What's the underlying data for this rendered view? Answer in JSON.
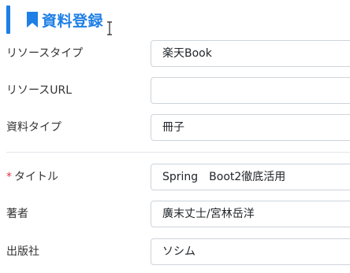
{
  "header": {
    "title": "資料登録"
  },
  "form": {
    "resource_type": {
      "label": "リソースタイプ",
      "value": "楽天Book"
    },
    "resource_url": {
      "label": "リソースURL",
      "value": ""
    },
    "material_type": {
      "label": "資料タイプ",
      "value": "冊子"
    },
    "title": {
      "required_mark": "*",
      "label": "タイトル",
      "value": "Spring　Boot2徹底活用"
    },
    "author": {
      "label": "著者",
      "value": "廣末丈士/宮林岳洋"
    },
    "publisher": {
      "label": "出版社",
      "value": "ソシム"
    }
  },
  "colors": {
    "accent": "#1e7fe6",
    "required": "#dc3545"
  },
  "icons": {
    "header": "bookmark-icon",
    "cursor": "text-cursor-icon"
  }
}
